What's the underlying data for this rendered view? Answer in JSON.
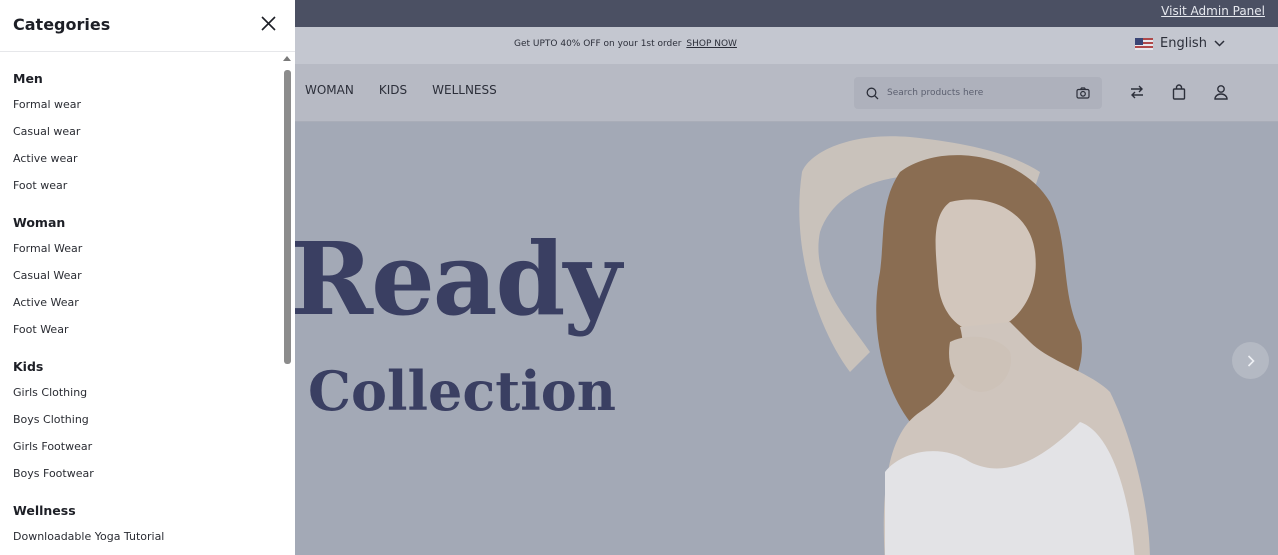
{
  "header": {
    "admin_link": "Visit Admin Panel",
    "promo_text": "Get UPTO 40% OFF on your 1st order",
    "promo_link": "SHOP NOW",
    "language": "English",
    "language_flag_icon": "us-flag-icon"
  },
  "nav": {
    "links": [
      "WOMAN",
      "KIDS",
      "WELLNESS"
    ],
    "search_placeholder": "Search products here"
  },
  "hero": {
    "title_line1": "Ready",
    "title_line2": "Collection"
  },
  "drawer": {
    "title": "Categories",
    "groups": [
      {
        "name": "Men",
        "items": [
          "Formal wear",
          "Casual wear",
          "Active wear",
          "Foot wear"
        ]
      },
      {
        "name": "Woman",
        "items": [
          "Formal Wear",
          "Casual Wear",
          "Active Wear",
          "Foot Wear"
        ]
      },
      {
        "name": "Kids",
        "items": [
          "Girls Clothing",
          "Boys Clothing",
          "Girls Footwear",
          "Boys Footwear"
        ]
      },
      {
        "name": "Wellness",
        "items": [
          "Downloadable Yoga Tutorial"
        ]
      }
    ]
  },
  "colors": {
    "overlay_dark": "#4b5063",
    "hero_bg": "#a3a9b6",
    "hero_text": "#3a3f62"
  }
}
